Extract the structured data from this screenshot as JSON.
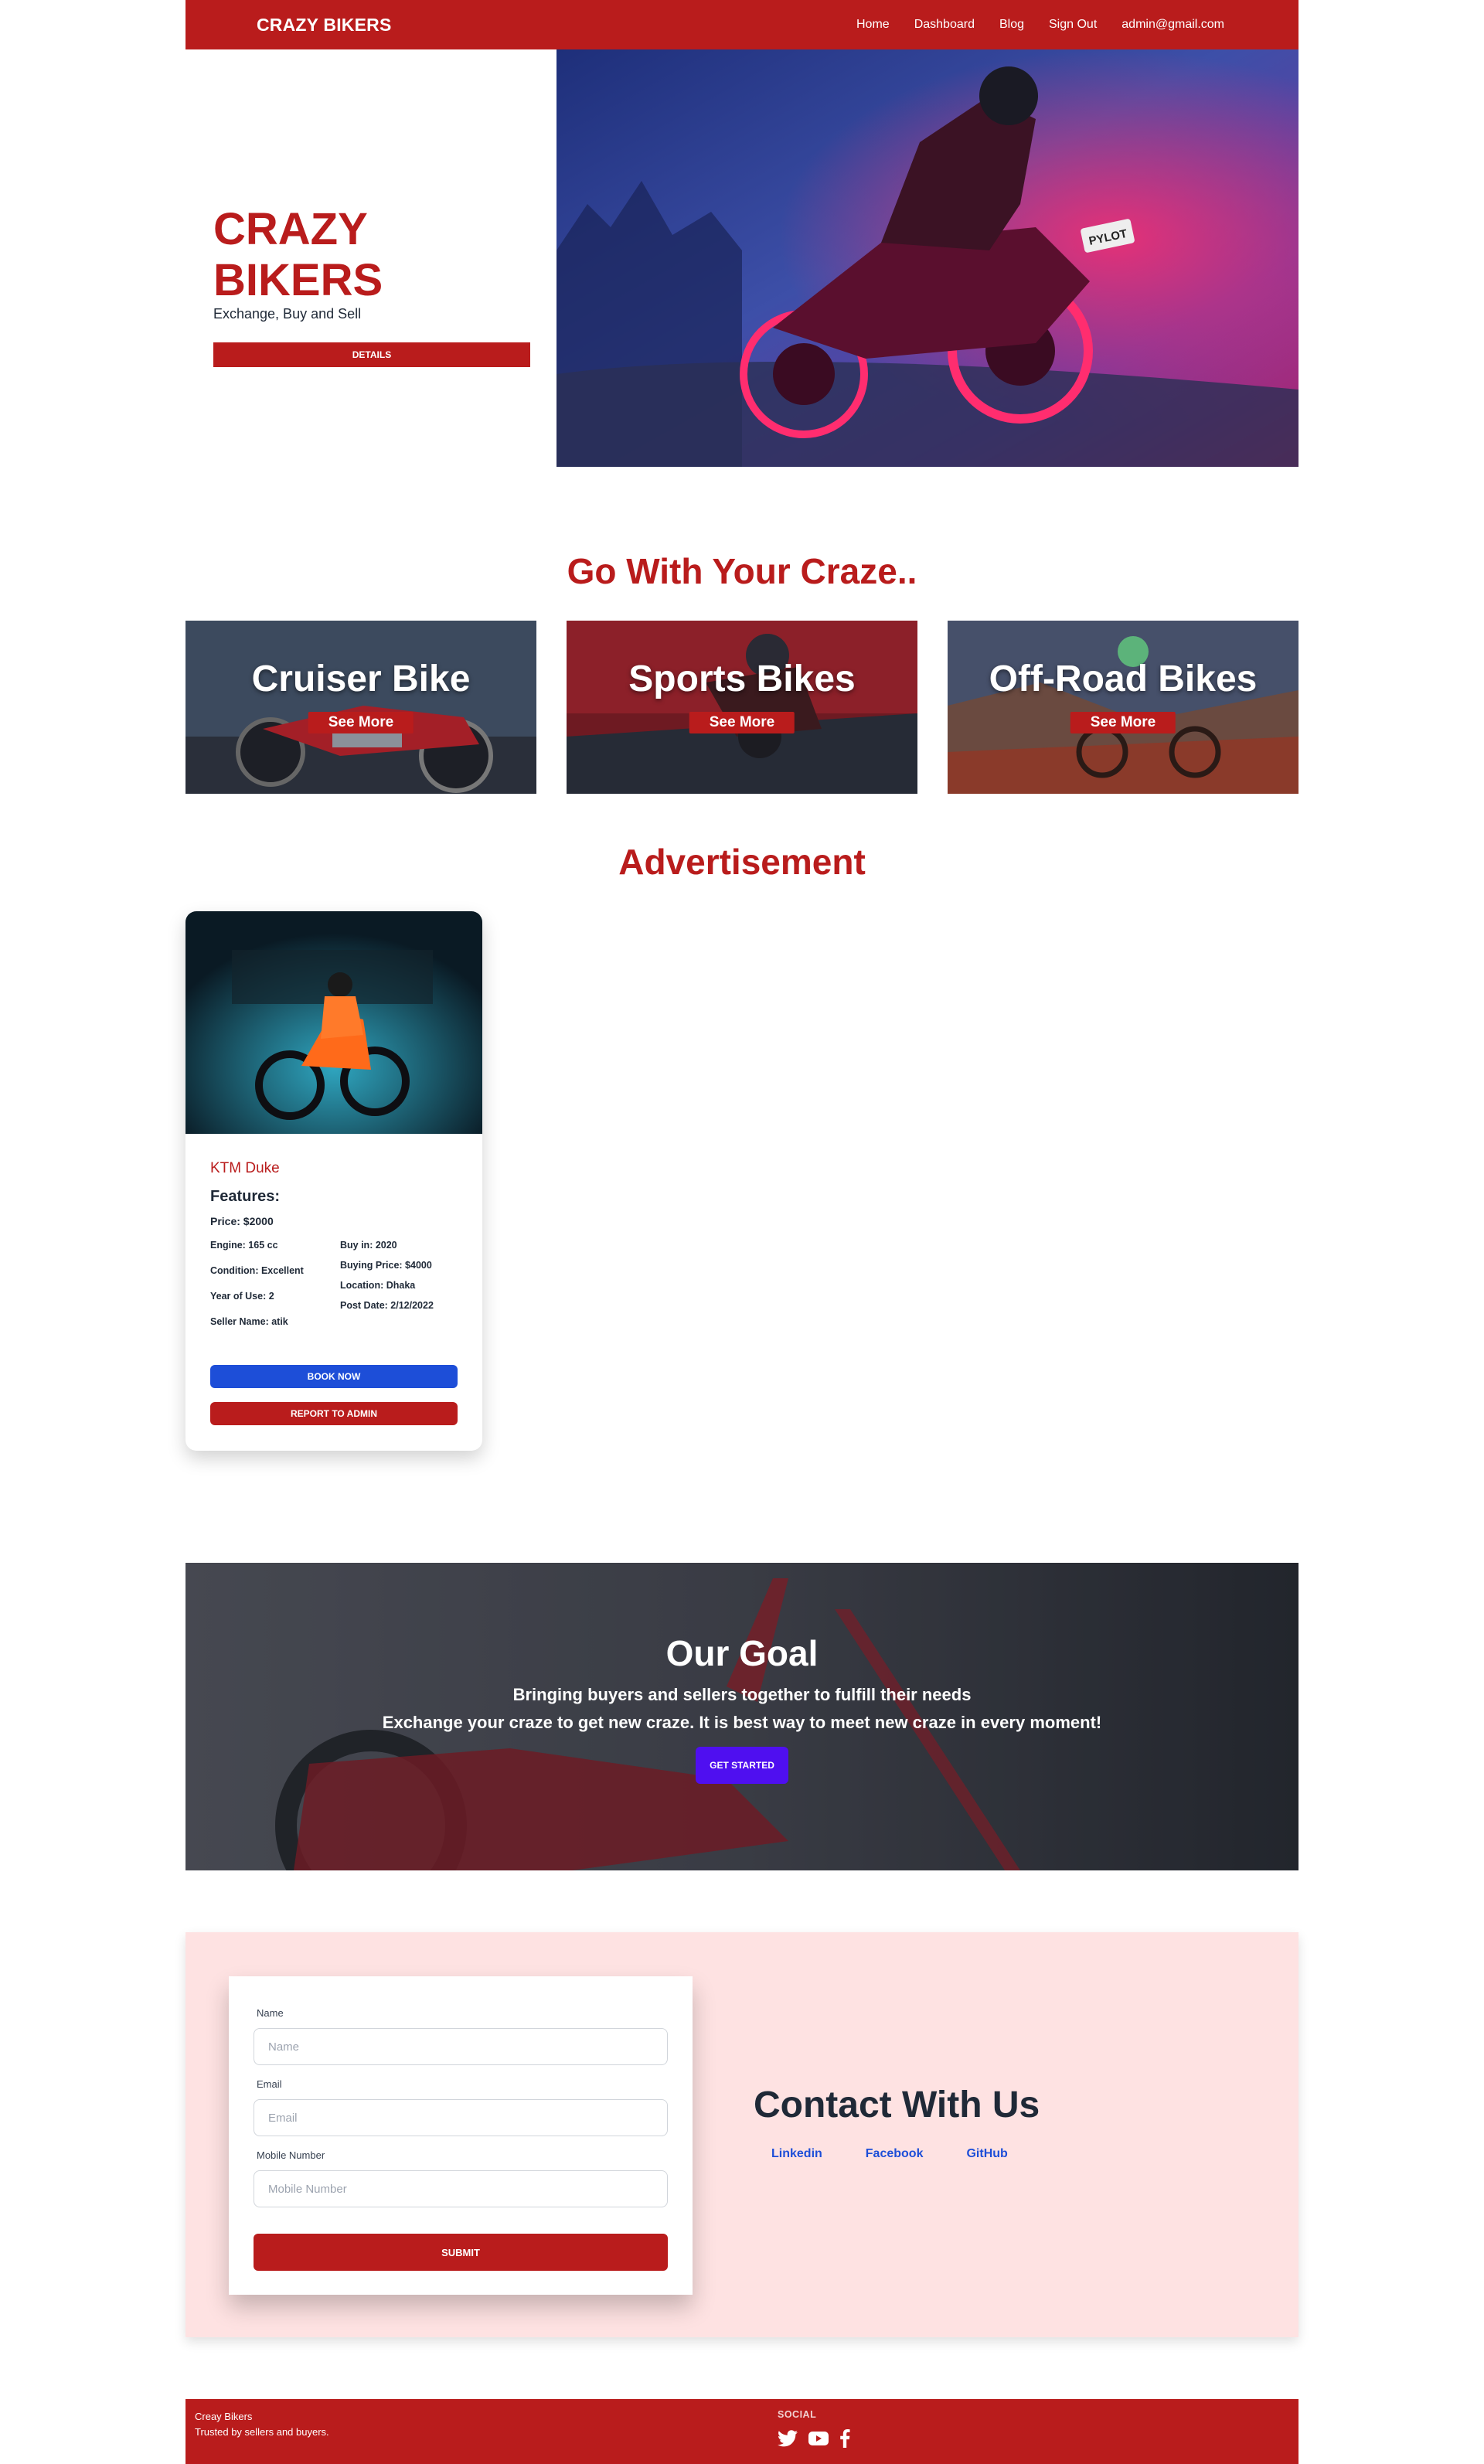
{
  "nav": {
    "brand": "CRAZY BIKERS",
    "links": [
      "Home",
      "Dashboard",
      "Blog",
      "Sign Out"
    ],
    "user_email": "admin@gmail.com"
  },
  "hero": {
    "title": "CRAZY BIKERS",
    "subtitle": "Exchange, Buy and Sell",
    "button": "DETAILS",
    "plate_text": "PYLOT"
  },
  "categories_section": {
    "title": "Go With Your Craze..",
    "items": [
      {
        "name": "Cruiser Bike",
        "button": "See More"
      },
      {
        "name": "Sports Bikes",
        "button": "See More"
      },
      {
        "name": "Off-Road Bikes",
        "button": "See More"
      }
    ]
  },
  "ads_section": {
    "title": "Advertisement",
    "card": {
      "name": "KTM Duke",
      "features_label": "Features:",
      "price": "Price: $2000",
      "left_specs": [
        "Engine: 165 cc",
        "Condition: Excellent",
        "Year of Use: 2",
        "Seller Name: atik"
      ],
      "right_specs": [
        "Buy in: 2020",
        "Buying Price: $4000",
        "Location: Dhaka",
        "Post Date: 2/12/2022"
      ],
      "book_button": "BOOK NOW",
      "report_button": "REPORT TO ADMIN"
    }
  },
  "goal": {
    "title": "Our Goal",
    "line1": "Bringing buyers and sellers together to fulfill their needs",
    "line2": "Exchange your craze to get new craze. It is best way to meet new craze in every moment!",
    "button": "GET STARTED"
  },
  "contact": {
    "name_label": "Name",
    "name_placeholder": "Name",
    "email_label": "Email",
    "email_placeholder": "Email",
    "mobile_label": "Mobile Number",
    "mobile_placeholder": "Mobile Number",
    "submit": "SUBMIT",
    "title": "Contact With Us",
    "links": [
      "Linkedin",
      "Facebook",
      "GitHub"
    ]
  },
  "footer": {
    "company": "Creay Bikers",
    "tagline": "Trusted by sellers and buyers.",
    "social_title": "SOCIAL",
    "icons": [
      "twitter-icon",
      "youtube-icon",
      "facebook-icon"
    ]
  },
  "colors": {
    "brand_red": "#b91c1c",
    "accent_blue": "#1d4ed8",
    "accent_purple": "#4f0ff0",
    "contact_bg": "#fee2e2"
  }
}
